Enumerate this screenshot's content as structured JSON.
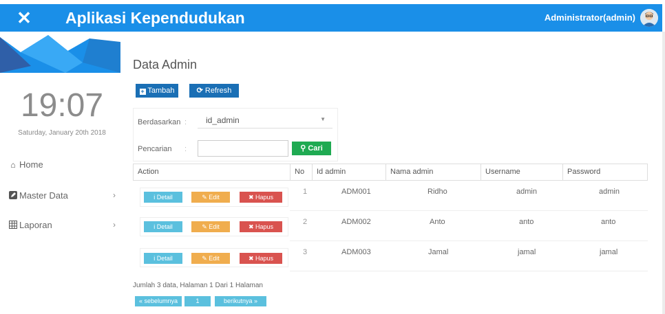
{
  "header": {
    "close_icon": "close-icon",
    "app_title": "Aplikasi Kependudukan",
    "user": "Administrator(admin)",
    "bar_color": "#1a8fe8"
  },
  "sidebar": {
    "clock": "19:07",
    "date": "Saturday, January 20th 2018",
    "items": [
      {
        "label": "Home",
        "icon": "home-icon",
        "chevron": ""
      },
      {
        "label": "Master Data",
        "icon": "edit-icon",
        "chevron": "›"
      },
      {
        "label": "Laporan",
        "icon": "table-icon",
        "chevron": "›"
      }
    ]
  },
  "main": {
    "title": "Data Admin",
    "buttons": {
      "add": "Tambah",
      "refresh": "Refresh"
    },
    "filter": {
      "by_label": "Berdasarkan",
      "by_value": "id_admin",
      "search_label": "Pencarian",
      "search_value": "",
      "search_button": "Cari"
    },
    "table": {
      "headers": [
        "Action",
        "No",
        "Id admin",
        "Nama admin",
        "Username",
        "Password"
      ],
      "action_labels": {
        "detail": "Detail",
        "edit": "Edit",
        "delete": "Hapus"
      },
      "rows": [
        {
          "no": "1",
          "id": "ADM001",
          "nama": "Ridho",
          "username": "admin",
          "password": "admin"
        },
        {
          "no": "2",
          "id": "ADM002",
          "nama": "Anto",
          "username": "anto",
          "password": "anto"
        },
        {
          "no": "3",
          "id": "ADM003",
          "nama": "Jamal",
          "username": "jamal",
          "password": "jamal"
        }
      ]
    },
    "footer": {
      "summary": "Jumlah 3 data, Halaman 1 Dari 1 Halaman",
      "prev": "« sebelumnya",
      "page": "1",
      "next": "berikutnya »"
    }
  },
  "colors": {
    "primary": "#1a6fb5",
    "success": "#1faa52",
    "detail": "#5bc0de",
    "edit": "#f0ad4e",
    "delete": "#d9534f"
  }
}
